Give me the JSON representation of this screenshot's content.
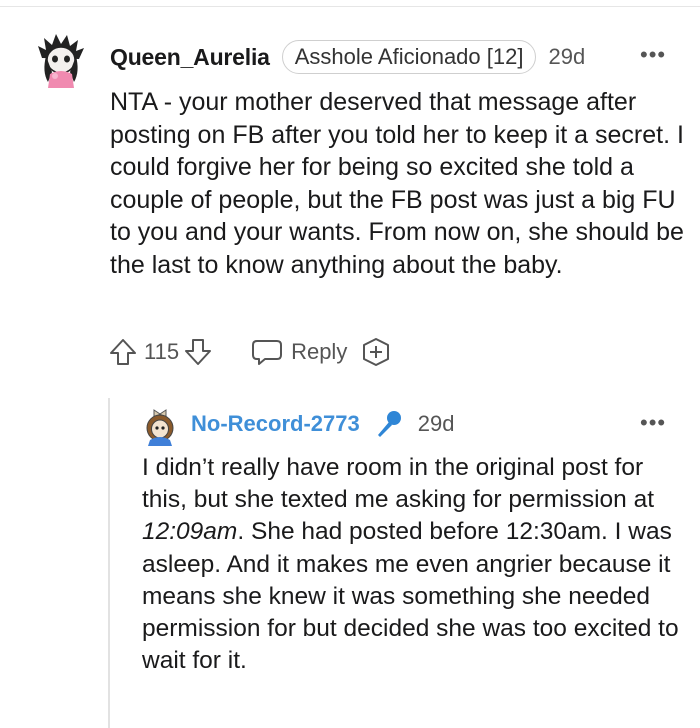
{
  "comments": [
    {
      "username": "Queen_Aurelia",
      "flair": "Asshole Aficionado [12]",
      "age": "29d",
      "more": "•••",
      "body": "NTA - your mother deserved that message after posting on FB after you told her to keep it a secret. I could forgive her for being so excited she told a couple of people, but the FB post was just a big FU to you and your wants. From now on, she should be the last to know anything about the baby.",
      "votes": "115",
      "reply_label": "Reply",
      "icons": [
        "upvote-arrow-icon",
        "downvote-arrow-icon",
        "reply-bubble-icon",
        "award-plus-icon",
        "overflow-dots-icon"
      ]
    },
    {
      "username": "No-Record-2773",
      "badge_icon": "microphone-icon",
      "age": "29d",
      "more": "•••",
      "body_before_time": "I didn’t really have room in the original post for this, but she texted me asking for permission at ",
      "body_time": "12:09am",
      "body_after_time": ". She had posted before 12:30am. I was asleep. And it makes me even angrier because it means she knew it was something she needed permission for but decided she was too excited to wait for it."
    }
  ],
  "colors": {
    "op_username": "#3f8fd8",
    "mic_badge": "#2f86d6",
    "meta_gray": "#555555",
    "thread_line": "#e2e2e2"
  }
}
